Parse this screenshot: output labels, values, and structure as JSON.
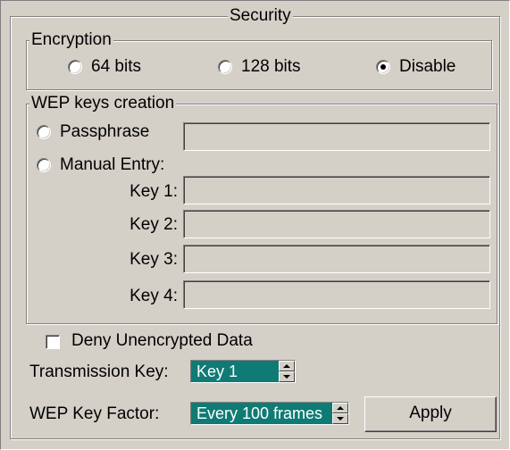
{
  "security": {
    "title": "Security",
    "encryption": {
      "title": "Encryption",
      "options": [
        "64 bits",
        "128 bits",
        "Disable"
      ],
      "selected": "Disable"
    },
    "wep": {
      "title": "WEP keys creation",
      "passphrase_label": "Passphrase",
      "passphrase_value": "",
      "manual_label": "Manual Entry:",
      "mode_selected": "none",
      "keys": [
        {
          "label": "Key 1:",
          "value": ""
        },
        {
          "label": "Key 2:",
          "value": ""
        },
        {
          "label": "Key 3:",
          "value": ""
        },
        {
          "label": "Key 4:",
          "value": ""
        }
      ]
    },
    "deny_unencrypted": {
      "label": "Deny Unencrypted Data",
      "checked": false
    },
    "transmission_key": {
      "label": "Transmission Key:",
      "value": "Key 1"
    },
    "wep_key_factor": {
      "label": "WEP Key Factor:",
      "value": "Every 100 frames"
    },
    "apply_label": "Apply"
  },
  "colors": {
    "panel_bg": "#d4d0c8",
    "selection_bg": "#0f7b74"
  },
  "icons": [
    "spin-up-arrow-icon",
    "spin-down-arrow-icon"
  ]
}
